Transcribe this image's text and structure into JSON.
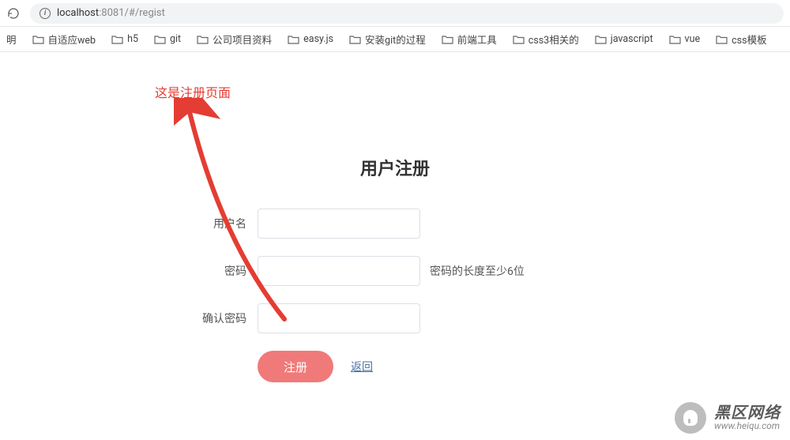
{
  "browser": {
    "url_host": "localhost",
    "url_port": ":8081",
    "url_path": "/#/regist"
  },
  "bookmarks": [
    {
      "label": "自适应web"
    },
    {
      "label": "h5"
    },
    {
      "label": "git"
    },
    {
      "label": "公司项目资料"
    },
    {
      "label": "easy.js"
    },
    {
      "label": "安装git的过程"
    },
    {
      "label": "前端工具"
    },
    {
      "label": "css3相关的"
    },
    {
      "label": "javascript"
    },
    {
      "label": "vue"
    },
    {
      "label": "css模板"
    }
  ],
  "annotation": {
    "note": "这是注册页面"
  },
  "form": {
    "title": "用户注册",
    "username_label": "用户名",
    "username_value": "",
    "password_label": "密码",
    "password_value": "",
    "password_hint": "密码的长度至少6位",
    "confirm_label": "确认密码",
    "confirm_value": "",
    "submit_label": "注册",
    "back_label": "返回"
  },
  "watermark": {
    "cn": "黑区网络",
    "en": "www.heiqu.com"
  }
}
